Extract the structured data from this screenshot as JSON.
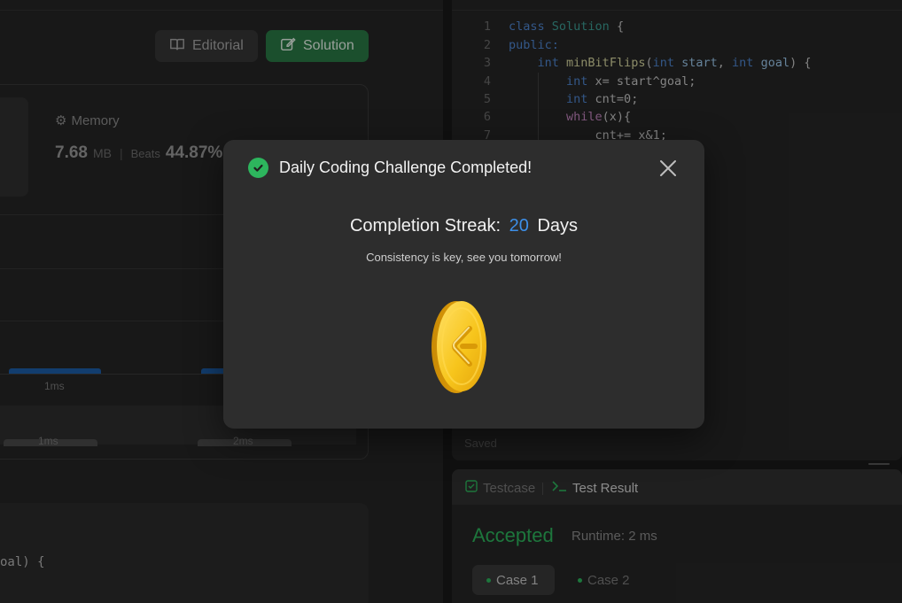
{
  "left": {
    "editorial_label": "Editorial",
    "solution_label": "Solution",
    "memory": {
      "title": "Memory",
      "value": "7.68",
      "unit": "MB",
      "beats_label": "Beats",
      "beats_pct": "44.87%"
    },
    "chart_ticks": {
      "upper": "1ms",
      "lower_1": "1ms",
      "lower_2": "2ms"
    },
    "code_fragment": "oal) {"
  },
  "editor": {
    "lines": [
      {
        "n": "1"
      },
      {
        "n": "2"
      },
      {
        "n": "3"
      },
      {
        "n": "4"
      },
      {
        "n": "5"
      },
      {
        "n": "6"
      },
      {
        "n": "7"
      }
    ],
    "code": {
      "l1_kw": "class",
      "l1_ty": "Solution",
      "l1_pl": " {",
      "l2_kw": "public:",
      "l3_kw": "int",
      "l3_fn": "minBitFlips",
      "l3_p1": "(",
      "l3_kw2": "int",
      "l3_v1": "start",
      "l3_p2": ", ",
      "l3_kw3": "int",
      "l3_v2": "goal",
      "l3_p3": ") {",
      "l4_kw": "int",
      "l4_pl": " x= start^goal;",
      "l5_kw": "int",
      "l5_pl": " cnt=0;",
      "l6_kw": "while",
      "l6_pl": "(x){",
      "l7_pl": "cnt+= x&1;"
    },
    "saved_label": "Saved"
  },
  "results": {
    "testcase_tab": "Testcase",
    "result_tab": "Test Result",
    "status": "Accepted",
    "runtime": "Runtime: 2 ms",
    "case_1": "Case 1",
    "case_2": "Case 2"
  },
  "modal": {
    "title": "Daily Coding Challenge Completed!",
    "streak_label": "Completion Streak:",
    "streak_value": "20",
    "streak_unit": "Days",
    "tagline": "Consistency is key, see you tomorrow!"
  },
  "colors": {
    "accent_green": "#2db55d",
    "streak_blue": "#3d8fe8",
    "coin_gold": "#f5c518"
  }
}
